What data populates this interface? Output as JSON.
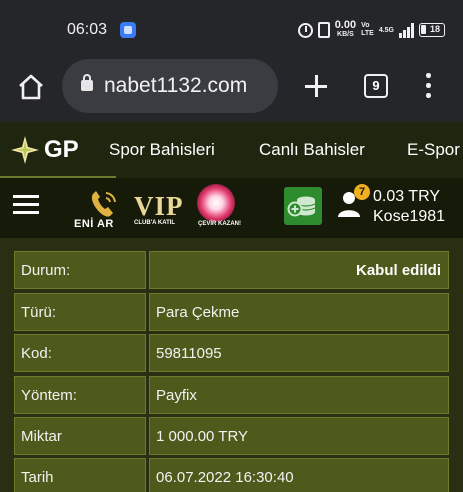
{
  "status_bar": {
    "time": "06:03",
    "net_speed_value": "0.00",
    "net_speed_unit": "KB/S",
    "volte_top": "Vo",
    "volte_bottom": "LTE",
    "signal_label": "4.5G",
    "battery": "18"
  },
  "browser": {
    "url": "nabet1132.com",
    "tab_count": "9"
  },
  "site_nav": {
    "logo_text": "GP",
    "items": [
      {
        "label": "Spor Bahisleri"
      },
      {
        "label": "Canlı Bahisler"
      },
      {
        "label": "E-Spor"
      }
    ]
  },
  "header": {
    "promo_phone_label": "ENİ AR",
    "vip_label": "VIP",
    "vip_sub": "CLUB'A KATIL",
    "wheel_label": "ÇEVİR KAZAN!",
    "notification_count": "7",
    "balance": "0.03 TRY",
    "username": "Kose1981"
  },
  "details": {
    "rows": [
      {
        "label": "Durum:",
        "value": "Kabul edildi"
      },
      {
        "label": "Türü:",
        "value": "Para Çekme"
      },
      {
        "label": "Kod:",
        "value": "59811095"
      },
      {
        "label": "Yöntem:",
        "value": "Payfix"
      },
      {
        "label": "Miktar",
        "value": "1 000.00 TRY"
      },
      {
        "label": "Tarih",
        "value": "06.07.2022 16:30:40"
      }
    ]
  },
  "colors": {
    "row_bg": "#4e5a1b",
    "page_bg": "#2a2f14",
    "deposit_green": "#2e8b2e",
    "badge": "#f0b020"
  }
}
